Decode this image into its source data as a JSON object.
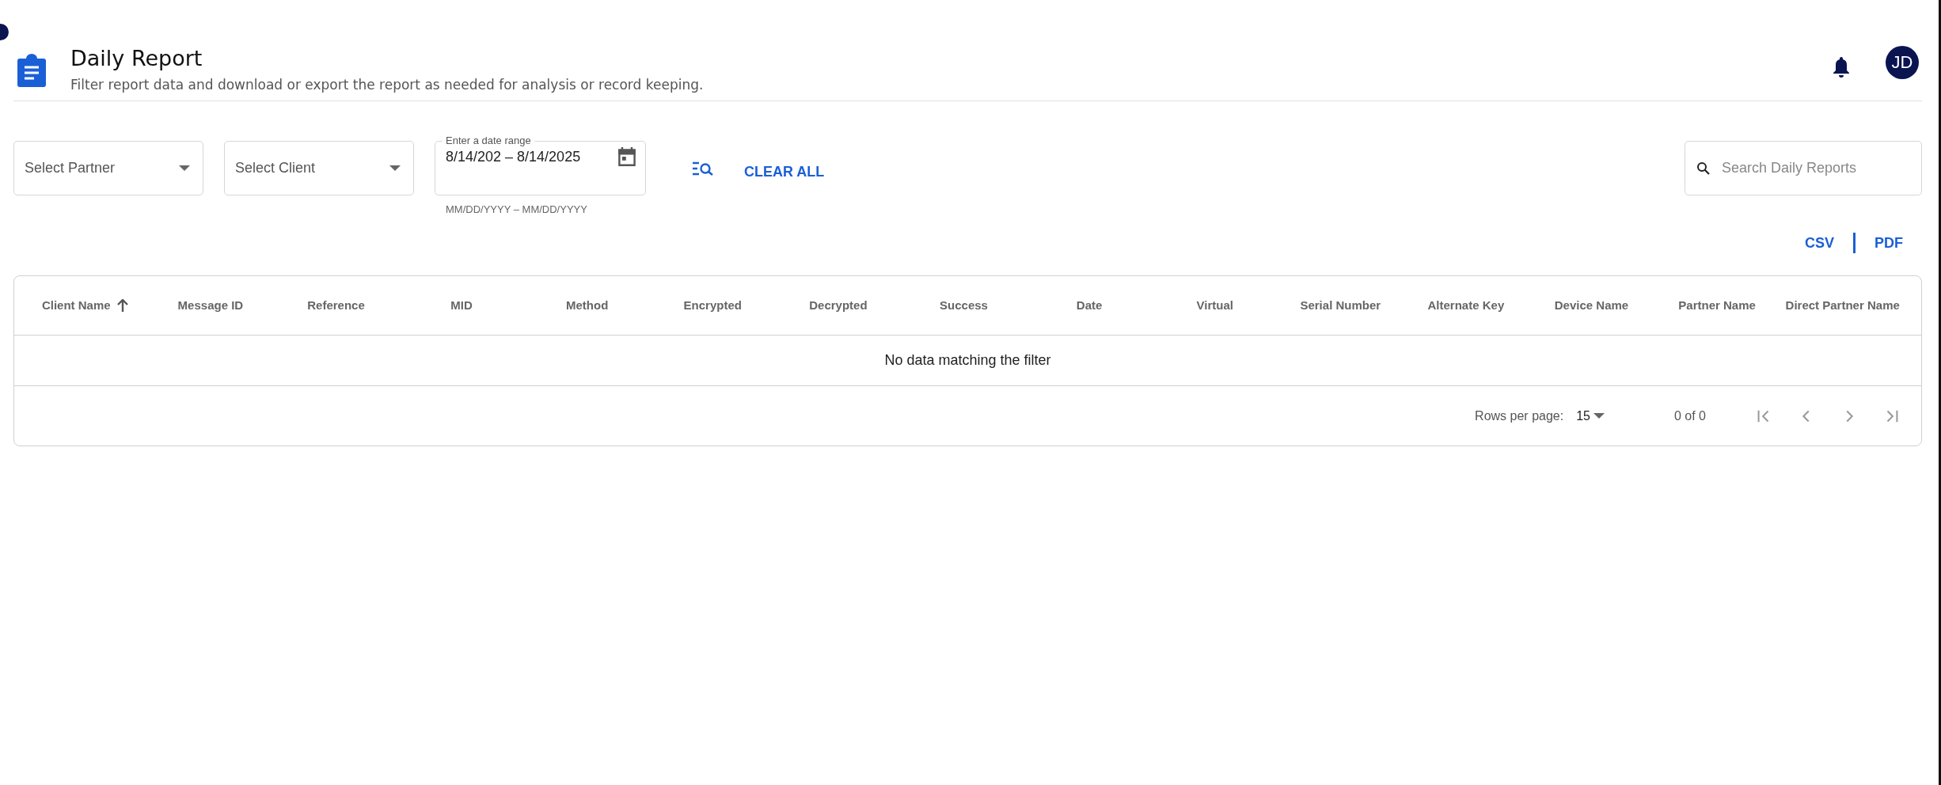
{
  "header": {
    "title": "Daily Report",
    "subtitle": "Filter report data and download or export the report as needed for analysis or record keeping.",
    "avatar": "JD"
  },
  "filters": {
    "partner": {
      "placeholder": "Select Partner"
    },
    "client": {
      "placeholder": "Select Client"
    },
    "date_range": {
      "label": "Enter a date range",
      "value": "8/14/202 – 8/14/2025",
      "helper": "MM/DD/YYYY – MM/DD/YYYY"
    },
    "clear": "CLEAR ALL",
    "search": {
      "placeholder": "Search Daily Reports"
    }
  },
  "exports": [
    "CSV",
    "PDF"
  ],
  "table": {
    "columns": [
      {
        "label": "Client Name",
        "sorted": true
      },
      {
        "label": "Message ID"
      },
      {
        "label": "Reference"
      },
      {
        "label": "MID"
      },
      {
        "label": "Method"
      },
      {
        "label": "Encrypted"
      },
      {
        "label": "Decrypted"
      },
      {
        "label": "Success"
      },
      {
        "label": "Date"
      },
      {
        "label": "Virtual"
      },
      {
        "label": "Serial Number"
      },
      {
        "label": "Alternate Key"
      },
      {
        "label": "Device Name"
      },
      {
        "label": "Partner Name"
      },
      {
        "label": "Direct Partner Name"
      }
    ],
    "empty": "No data matching the filter",
    "pagination": {
      "rows_label": "Rows per page:",
      "rows_value": "15",
      "range": "0 of 0"
    }
  }
}
